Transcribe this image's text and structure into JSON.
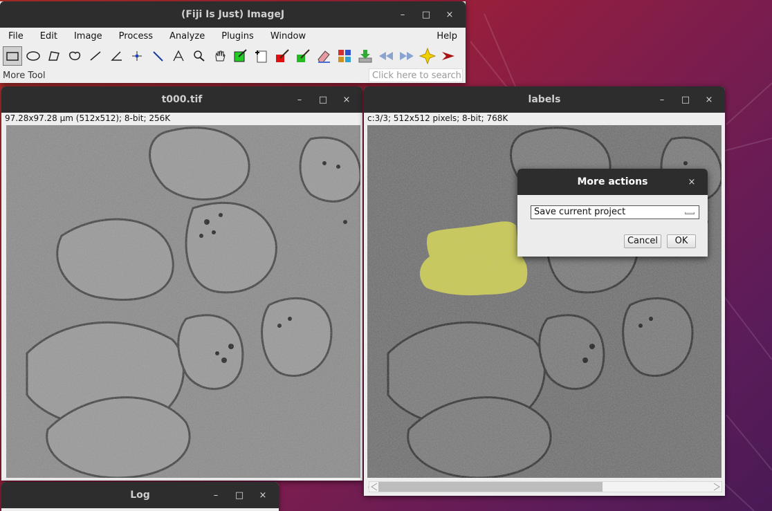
{
  "imagej": {
    "title": "(Fiji Is Just) ImageJ",
    "menus": [
      "File",
      "Edit",
      "Image",
      "Process",
      "Analyze",
      "Plugins",
      "Window"
    ],
    "help": "Help",
    "status_label": "More Tool",
    "search_placeholder": "Click here to search",
    "controls": {
      "minimize": "–",
      "maximize": "□",
      "close": "×"
    }
  },
  "t000": {
    "title": "t000.tif",
    "info": "97.28x97.28 µm (512x512); 8-bit; 256K"
  },
  "labels": {
    "title": "labels",
    "info": "c:3/3; 512x512 pixels; 8-bit; 768K",
    "channel_label": "c"
  },
  "dialog": {
    "title": "More actions",
    "selected_option": "Save current project",
    "cancel": "Cancel",
    "ok": "OK",
    "close": "×"
  },
  "log": {
    "title": "Log"
  },
  "colors": {
    "titlebar": "#2d2d2d",
    "window_bg": "#eeeeee",
    "overlay_yellow": "#d4d44a"
  }
}
